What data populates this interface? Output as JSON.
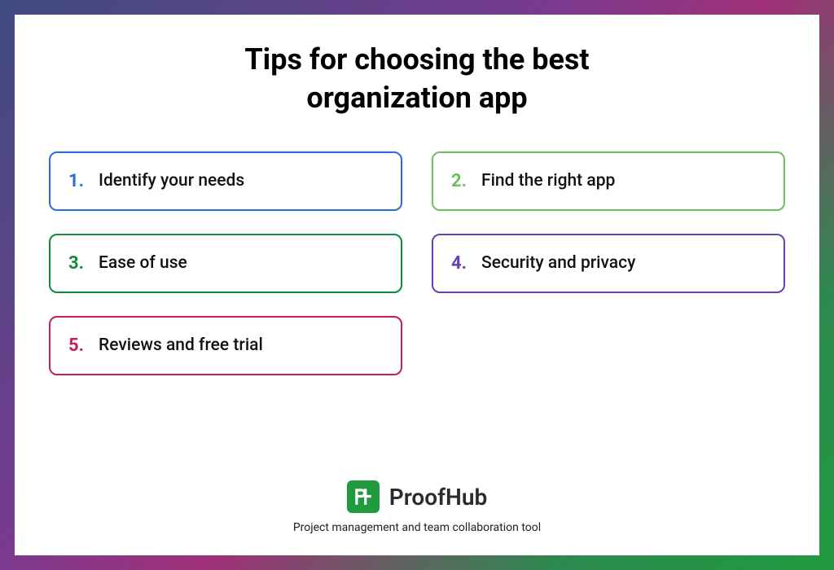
{
  "title": "Tips for choosing the best organization app",
  "tips": [
    {
      "num": "1.",
      "text": "Identify your needs",
      "color": "#2a6fd6"
    },
    {
      "num": "2.",
      "text": "Find the right app",
      "color": "#6fbf5f"
    },
    {
      "num": "3.",
      "text": "Ease of use",
      "color": "#118a3b"
    },
    {
      "num": "4.",
      "text": "Security and privacy",
      "color": "#6a3fb0"
    },
    {
      "num": "5.",
      "text": "Reviews and free trial",
      "color": "#c01f5a"
    }
  ],
  "brand": {
    "name": "ProofHub",
    "tagline": "Project management and team collaboration tool",
    "logo_bg": "#1f9a3f"
  }
}
